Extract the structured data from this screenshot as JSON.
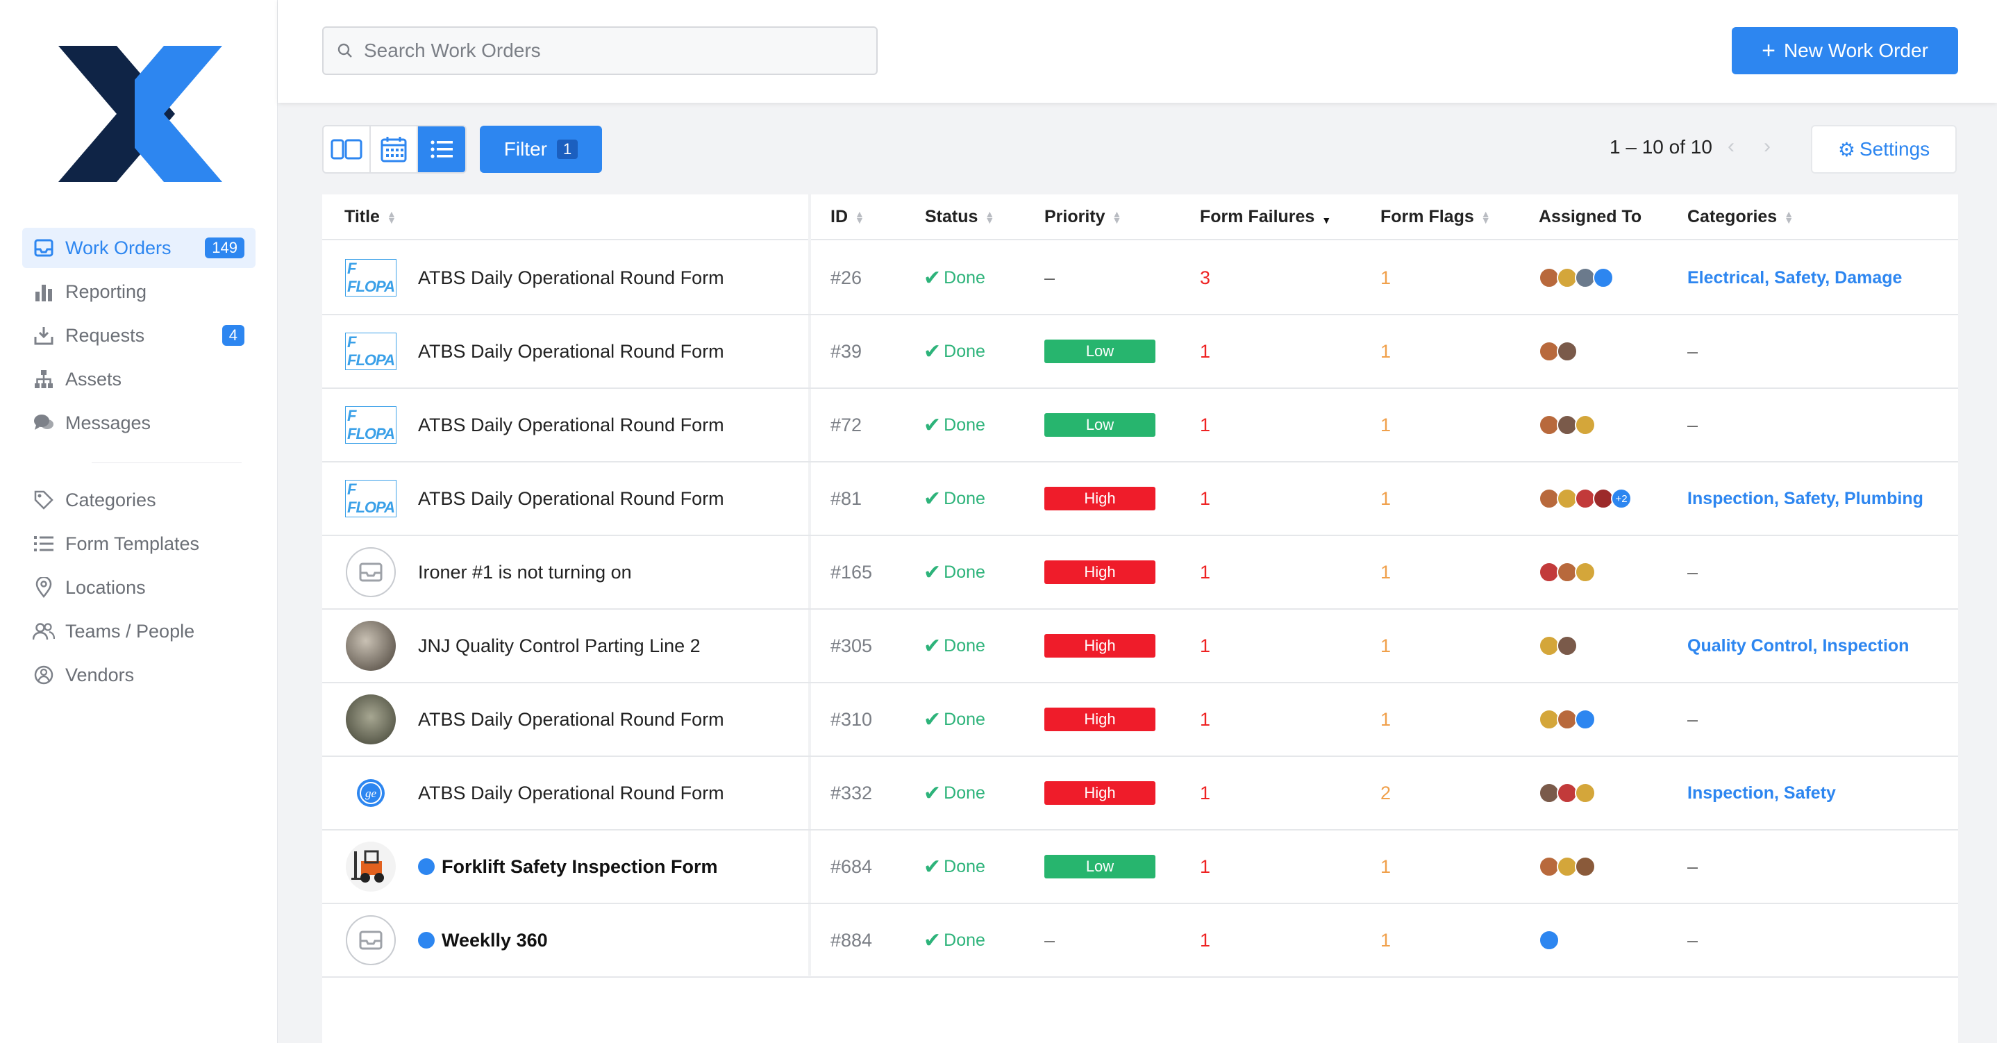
{
  "sidebar": {
    "items": [
      {
        "label": "Work Orders",
        "badge": "149",
        "icon": "inbox-icon",
        "active": true
      },
      {
        "label": "Reporting",
        "badge": "",
        "icon": "bar-chart-icon"
      },
      {
        "label": "Requests",
        "badge": "4",
        "icon": "tray-download-icon"
      },
      {
        "label": "Assets",
        "badge": "",
        "icon": "hierarchy-icon"
      },
      {
        "label": "Messages",
        "badge": "",
        "icon": "chat-bubbles-icon"
      }
    ],
    "secondary": [
      {
        "label": "Categories",
        "icon": "tag-icon"
      },
      {
        "label": "Form Templates",
        "icon": "list-icon"
      },
      {
        "label": "Locations",
        "icon": "map-pin-icon"
      },
      {
        "label": "Teams / People",
        "icon": "people-icon"
      },
      {
        "label": "Vendors",
        "icon": "vendors-icon"
      }
    ]
  },
  "topbar": {
    "search_placeholder": "Search Work Orders",
    "new_button": "New Work Order"
  },
  "toolbar": {
    "filter_label": "Filter",
    "filter_count": "1",
    "pager": "1 – 10 of 10",
    "settings_label": "Settings"
  },
  "table": {
    "columns": [
      "Title",
      "ID",
      "Status",
      "Priority",
      "Form Failures",
      "Form Flags",
      "Assigned To",
      "Categories"
    ],
    "rows": [
      {
        "thumb": "logo",
        "title": "ATBS Daily Operational Round Form",
        "bold": false,
        "dot": false,
        "id": "#26",
        "status": "Done",
        "priority": "–",
        "failures": "3",
        "flags": "1",
        "avatars": [
          "#b8693c",
          "#d4a63a",
          "#6b7a8c",
          "#2d86f0"
        ],
        "more": "",
        "categories": "Electrical, Safety, Damage"
      },
      {
        "thumb": "logo",
        "title": "ATBS Daily Operational Round Form",
        "bold": false,
        "dot": false,
        "id": "#39",
        "status": "Done",
        "priority": "Low",
        "failures": "1",
        "flags": "1",
        "avatars": [
          "#b8693c",
          "#7a5a4a"
        ],
        "more": "",
        "categories": "–"
      },
      {
        "thumb": "logo",
        "title": "ATBS Daily Operational Round Form",
        "bold": false,
        "dot": false,
        "id": "#72",
        "status": "Done",
        "priority": "Low",
        "failures": "1",
        "flags": "1",
        "avatars": [
          "#b8693c",
          "#7a5a4a",
          "#d4a63a"
        ],
        "more": "",
        "categories": "–"
      },
      {
        "thumb": "logo",
        "title": "ATBS Daily Operational Round Form",
        "bold": false,
        "dot": false,
        "id": "#81",
        "status": "Done",
        "priority": "High",
        "failures": "1",
        "flags": "1",
        "avatars": [
          "#b8693c",
          "#d4a63a",
          "#c23a3a",
          "#9c2a2a"
        ],
        "more": "+2",
        "categories": "Inspection, Safety, Plumbing"
      },
      {
        "thumb": "inbox",
        "title": "Ironer #1 is not turning on",
        "bold": false,
        "dot": false,
        "id": "#165",
        "status": "Done",
        "priority": "High",
        "failures": "1",
        "flags": "1",
        "avatars": [
          "#c23a3a",
          "#b8693c",
          "#d4a63a"
        ],
        "more": "",
        "categories": "–"
      },
      {
        "thumb": "photo1",
        "title": "JNJ Quality Control Parting Line 2",
        "bold": false,
        "dot": false,
        "id": "#305",
        "status": "Done",
        "priority": "High",
        "failures": "1",
        "flags": "1",
        "avatars": [
          "#d4a63a",
          "#7a5a4a"
        ],
        "more": "",
        "categories": "Quality Control, Inspection"
      },
      {
        "thumb": "photo2",
        "title": "ATBS Daily Operational Round Form",
        "bold": false,
        "dot": false,
        "id": "#310",
        "status": "Done",
        "priority": "High",
        "failures": "1",
        "flags": "1",
        "avatars": [
          "#d4a63a",
          "#b8693c",
          "#2d86f0"
        ],
        "more": "",
        "categories": "–"
      },
      {
        "thumb": "ge",
        "title": "ATBS Daily Operational Round Form",
        "bold": false,
        "dot": false,
        "id": "#332",
        "status": "Done",
        "priority": "High",
        "failures": "1",
        "flags": "2",
        "avatars": [
          "#7a5a4a",
          "#c23a3a",
          "#d4a63a"
        ],
        "more": "",
        "categories": "Inspection, Safety"
      },
      {
        "thumb": "forklift",
        "title": "Forklift Safety Inspection Form",
        "bold": true,
        "dot": true,
        "id": "#684",
        "status": "Done",
        "priority": "Low",
        "failures": "1",
        "flags": "1",
        "avatars": [
          "#b8693c",
          "#d4a63a",
          "#8a5a3a"
        ],
        "more": "",
        "categories": "–"
      },
      {
        "thumb": "inbox",
        "title": "Weeklly 360",
        "bold": true,
        "dot": true,
        "id": "#884",
        "status": "Done",
        "priority": "–",
        "failures": "1",
        "flags": "1",
        "avatars": [
          "#2d86f0"
        ],
        "more": "",
        "categories": "–"
      }
    ]
  },
  "colors": {
    "accent": "#2d86f0",
    "done": "#2db37a",
    "low": "#27b56e",
    "high": "#ef1c2a",
    "failure": "#ee2222",
    "flag": "#f0a04b",
    "logo_dark": "#0f2446",
    "logo_light": "#2d86f0"
  }
}
